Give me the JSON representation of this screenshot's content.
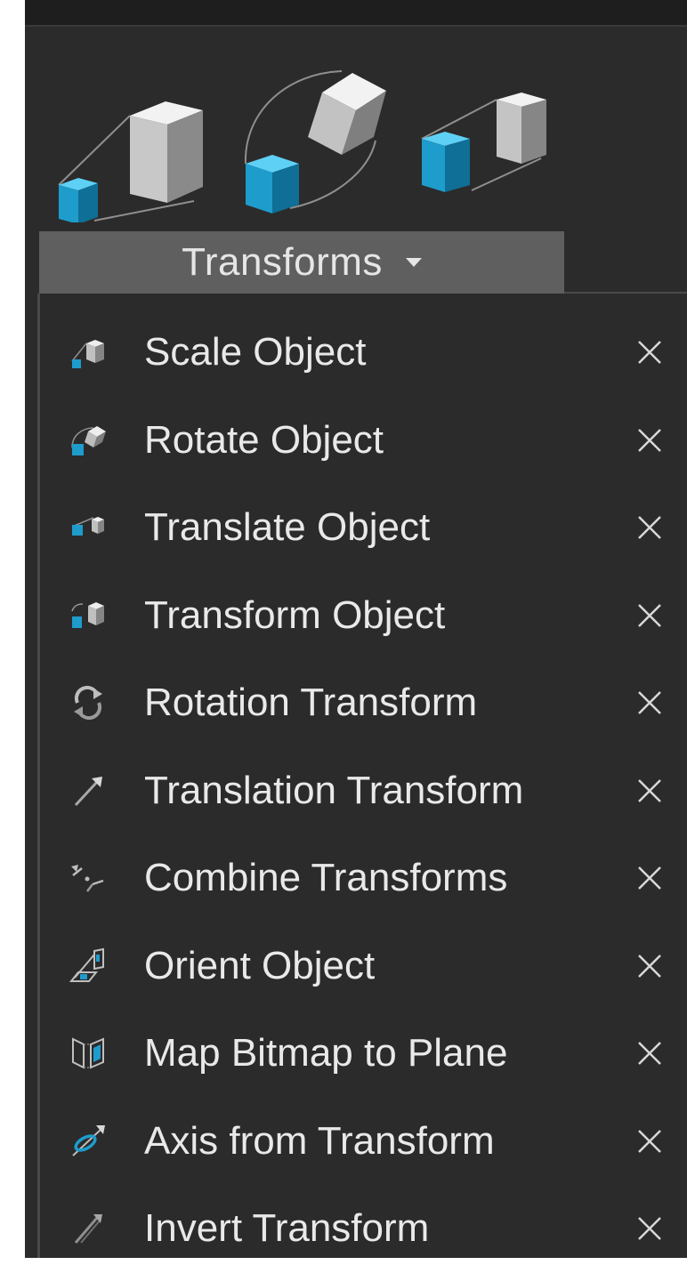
{
  "toolbar": {
    "buttons": [
      {
        "name": "Scale Object",
        "icon": "scale-object-icon"
      },
      {
        "name": "Rotate Object",
        "icon": "rotate-object-icon"
      },
      {
        "name": "Translate Object",
        "icon": "translate-object-icon"
      }
    ],
    "category_label": "Transforms"
  },
  "menu": {
    "items": [
      {
        "label": "Scale Object",
        "icon": "scale-object-icon"
      },
      {
        "label": "Rotate Object",
        "icon": "rotate-object-icon"
      },
      {
        "label": "Translate Object",
        "icon": "translate-object-icon"
      },
      {
        "label": "Transform Object",
        "icon": "transform-object-icon"
      },
      {
        "label": "Rotation Transform",
        "icon": "rotation-transform-icon"
      },
      {
        "label": "Translation Transform",
        "icon": "translation-transform-icon"
      },
      {
        "label": "Combine Transforms",
        "icon": "combine-transforms-icon"
      },
      {
        "label": "Orient Object",
        "icon": "orient-object-icon"
      },
      {
        "label": "Map Bitmap to Plane",
        "icon": "map-bitmap-icon"
      },
      {
        "label": "Axis from Transform",
        "icon": "axis-from-transform-icon"
      },
      {
        "label": "Invert Transform",
        "icon": "invert-transform-icon"
      }
    ]
  },
  "colors": {
    "panel_bg": "#2b2b2b",
    "category_bg": "#5f5f5f",
    "text": "#e9e9e9",
    "accent_cube": "#1fa3d4"
  }
}
